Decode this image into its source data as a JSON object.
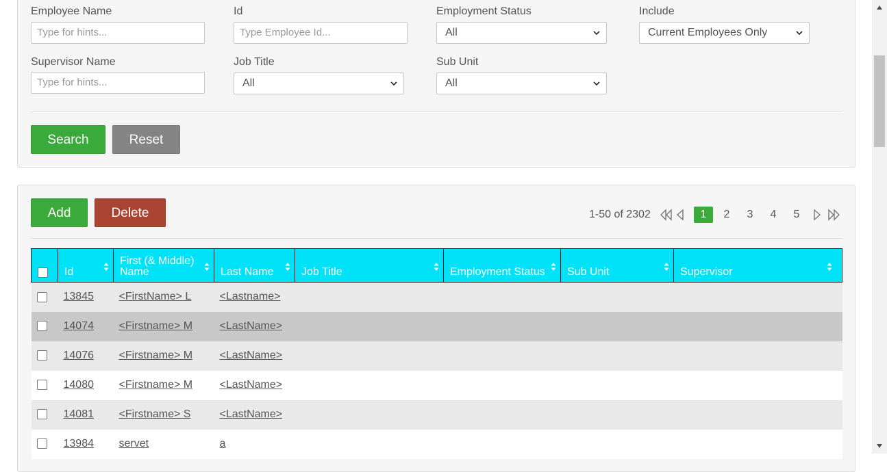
{
  "filters": {
    "employee_name": {
      "label": "Employee Name",
      "placeholder": "Type for hints..."
    },
    "id": {
      "label": "Id",
      "placeholder": "Type Employee Id..."
    },
    "employment_status": {
      "label": "Employment Status",
      "value": "All"
    },
    "include": {
      "label": "Include",
      "value": "Current Employees Only"
    },
    "supervisor_name": {
      "label": "Supervisor Name",
      "placeholder": "Type for hints..."
    },
    "job_title": {
      "label": "Job Title",
      "value": "All"
    },
    "sub_unit": {
      "label": "Sub Unit",
      "value": "All"
    },
    "search_label": "Search",
    "reset_label": "Reset"
  },
  "toolbar": {
    "add_label": "Add",
    "delete_label": "Delete"
  },
  "pagination": {
    "summary": "1-50 of 2302",
    "pages": [
      "1",
      "2",
      "3",
      "4",
      "5"
    ],
    "current_page": "1"
  },
  "table": {
    "columns": [
      "Id",
      "First (& Middle) Name",
      "Last Name",
      "Job Title",
      "Employment Status",
      "Sub Unit",
      "Supervisor"
    ],
    "rows": [
      {
        "id": "13845",
        "first": "<FirstName> L",
        "last": "<Lastname>",
        "job": "",
        "status": "",
        "unit": "",
        "supervisor": ""
      },
      {
        "id": "14074",
        "first": "<Firstname> M",
        "last": "<LastName>",
        "job": "",
        "status": "",
        "unit": "",
        "supervisor": ""
      },
      {
        "id": "14076",
        "first": "<Firstname> M",
        "last": "<LastName>",
        "job": "",
        "status": "",
        "unit": "",
        "supervisor": ""
      },
      {
        "id": "14080",
        "first": "<Firstname> M",
        "last": "<LastName>",
        "job": "",
        "status": "",
        "unit": "",
        "supervisor": ""
      },
      {
        "id": "14081",
        "first": "<Firstname> S",
        "last": "<LastName>",
        "job": "",
        "status": "",
        "unit": "",
        "supervisor": ""
      },
      {
        "id": "13984",
        "first": "servet",
        "last": "a",
        "job": "",
        "status": "",
        "unit": "",
        "supervisor": ""
      }
    ]
  },
  "colors": {
    "header_bg": "#00e2f8",
    "success": "#3aaa3a",
    "danger": "#a94433",
    "neutral": "#848484",
    "row_highlight": "#c8c8c8"
  },
  "icons": {
    "select": "chevron-down-icon",
    "sort": "sort-icon",
    "first_page": "double-chevron-left-icon",
    "prev_page": "chevron-left-icon",
    "next_page": "chevron-right-icon",
    "last_page": "double-chevron-right-icon"
  }
}
